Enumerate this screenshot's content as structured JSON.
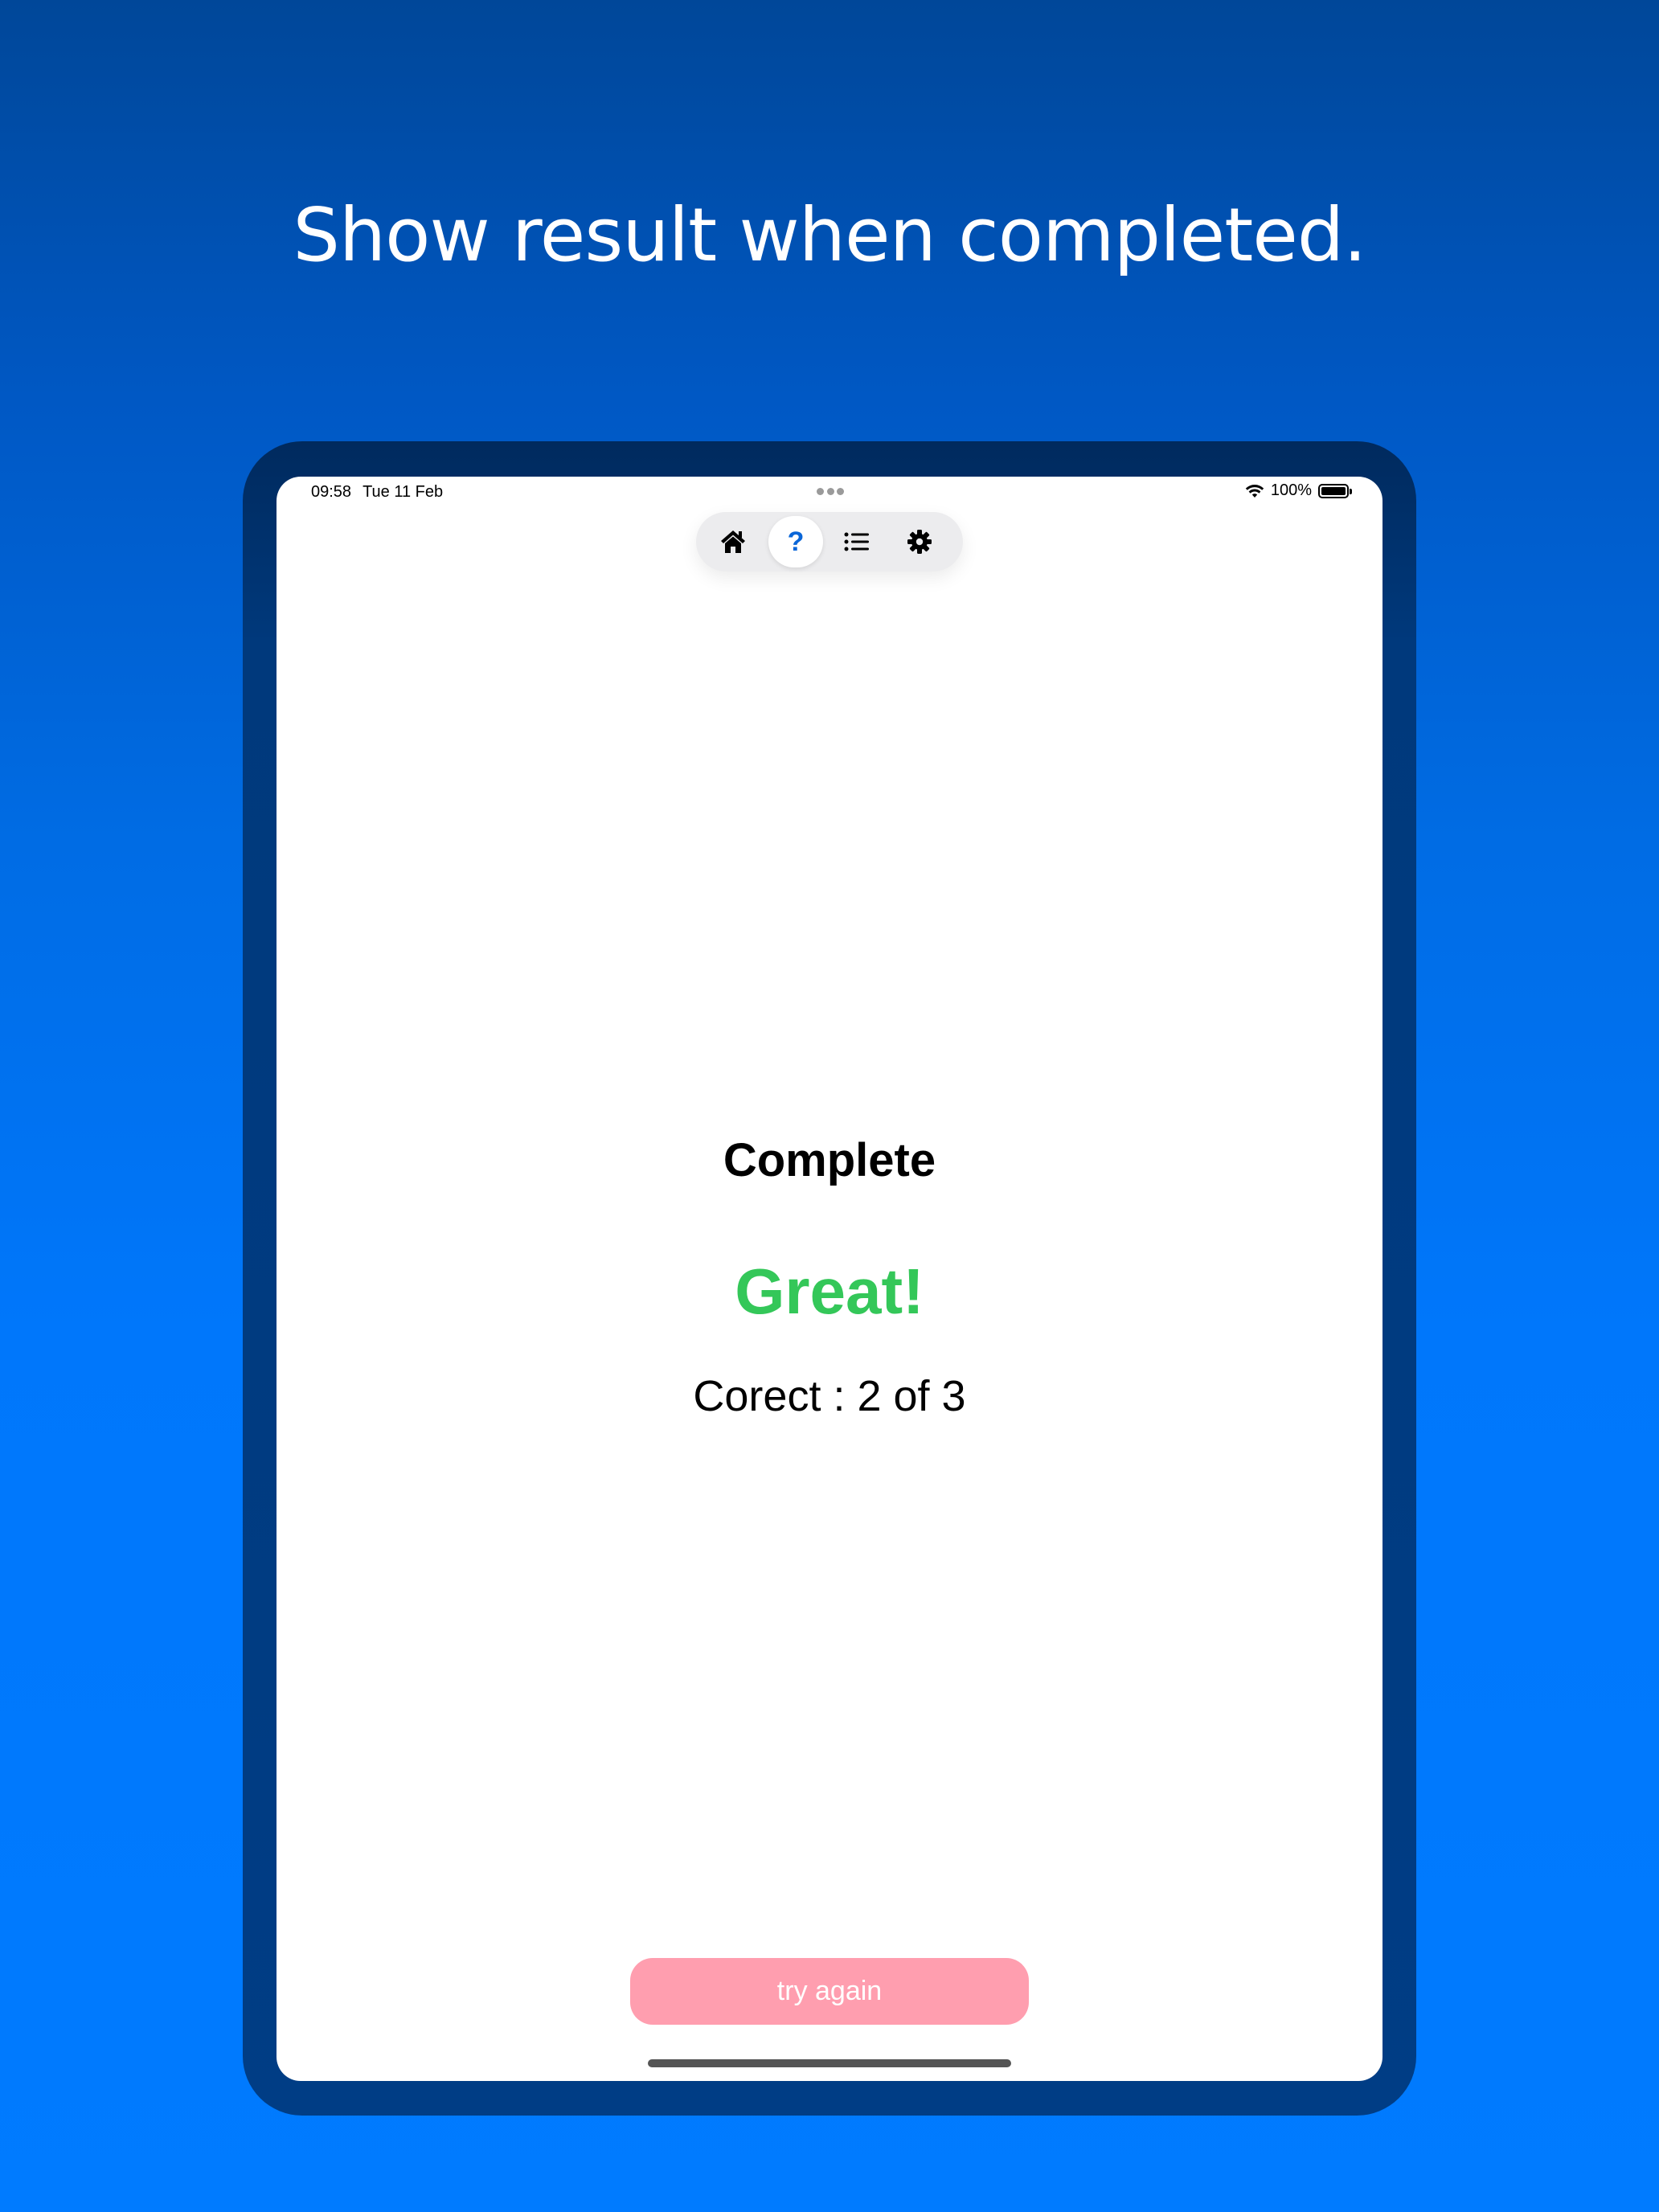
{
  "headline": "Show result when completed.",
  "status_bar": {
    "time": "09:58",
    "date": "Tue 11 Feb",
    "battery_text": "100%",
    "battery_level": 1.0,
    "wifi_icon": "wifi-icon",
    "battery_icon": "battery-icon"
  },
  "tabs": [
    {
      "name": "home",
      "icon": "house-icon",
      "active": false
    },
    {
      "name": "quiz",
      "icon": "question-icon",
      "glyph": "?",
      "active": true
    },
    {
      "name": "list",
      "icon": "list-icon",
      "active": false
    },
    {
      "name": "settings",
      "icon": "gear-icon",
      "active": false
    }
  ],
  "result": {
    "title": "Complete",
    "verdict": "Great!",
    "score": "Corect : 2 of 3"
  },
  "actions": {
    "try_again_label": "try again"
  },
  "colors": {
    "verdict": "#34c759",
    "button": "#ff9eaf",
    "active_tab_icon": "#0a66d8"
  }
}
